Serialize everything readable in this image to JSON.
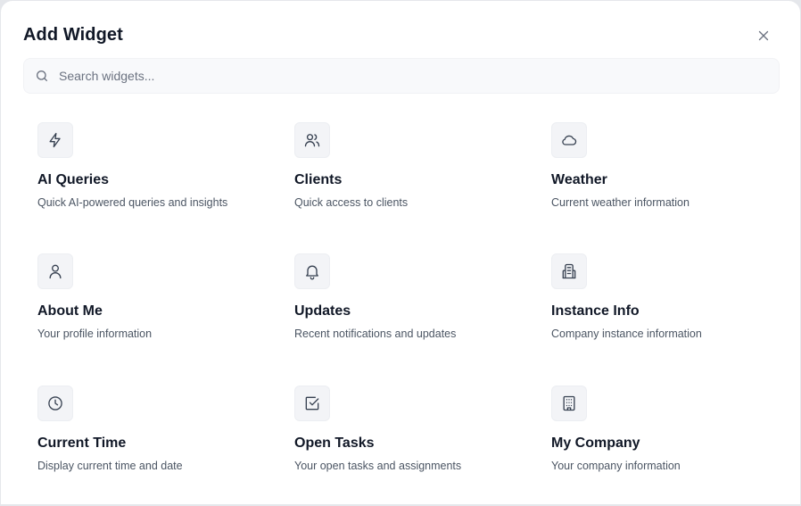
{
  "dialog": {
    "title": "Add Widget",
    "close_icon": "close-icon"
  },
  "search": {
    "placeholder": "Search widgets...",
    "value": "",
    "icon": "search-icon"
  },
  "widgets": [
    {
      "title": "AI Queries",
      "description": "Quick AI-powered queries and insights",
      "icon": "lightning-icon"
    },
    {
      "title": "Clients",
      "description": "Quick access to clients",
      "icon": "users-icon"
    },
    {
      "title": "Weather",
      "description": "Current weather information",
      "icon": "cloud-icon"
    },
    {
      "title": "About Me",
      "description": "Your profile information",
      "icon": "user-icon"
    },
    {
      "title": "Updates",
      "description": "Recent notifications and updates",
      "icon": "bell-icon"
    },
    {
      "title": "Instance Info",
      "description": "Company instance information",
      "icon": "building-2-icon"
    },
    {
      "title": "Current Time",
      "description": "Display current time and date",
      "icon": "clock-icon"
    },
    {
      "title": "Open Tasks",
      "description": "Your open tasks and assignments",
      "icon": "check-square-icon"
    },
    {
      "title": "My Company",
      "description": "Your company information",
      "icon": "building-icon"
    }
  ],
  "colors": {
    "text_primary": "#111827",
    "text_secondary": "#4b5563",
    "icon_stroke": "#374151",
    "icon_bg": "#f3f4f7"
  }
}
